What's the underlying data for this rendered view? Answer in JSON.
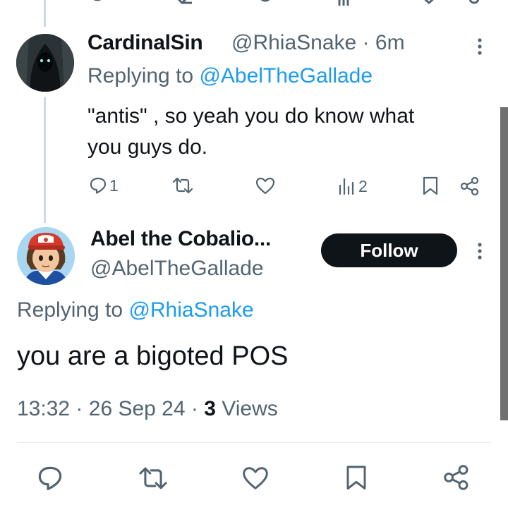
{
  "reply_tweet": {
    "display_name": "CardinalSin",
    "handle": "@RhiaSnake",
    "separator": "·",
    "time_ago": "6m",
    "replying_prefix": "Replying to",
    "replying_to": "@AbelTheGallade",
    "text_line1": "\"antis\" , so yeah you do know what",
    "text_line2": "you guys do.",
    "reply_count": "1",
    "views_count": "2"
  },
  "main_tweet": {
    "display_name": "Abel the Cobalio...",
    "handle": "@AbelTheGallade",
    "follow_label": "Follow",
    "replying_prefix": "Replying to",
    "replying_to": "@RhiaSnake",
    "text": "you are a bigoted POS",
    "time": "13:32",
    "date": "26 Sep 24",
    "separator": "·",
    "views_count": "3",
    "views_label": "Views"
  },
  "colors": {
    "text": "#0f1419",
    "muted": "#536471",
    "link": "#1d9bf0",
    "follow_bg": "#0f1419",
    "thread_line": "#cfd9de",
    "scrollbar": "#707070"
  },
  "icons": [
    "reply-icon",
    "retweet-icon",
    "like-icon",
    "views-icon",
    "bookmark-icon",
    "share-icon",
    "more-icon"
  ]
}
